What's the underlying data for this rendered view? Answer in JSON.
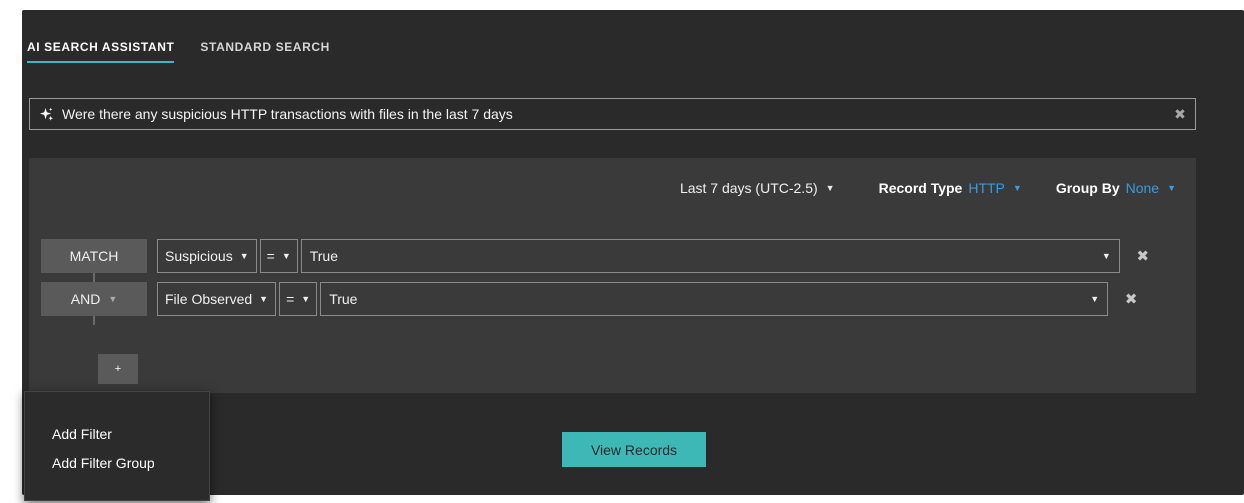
{
  "tabs": [
    {
      "label": "AI SEARCH ASSISTANT",
      "active": true
    },
    {
      "label": "STANDARD SEARCH",
      "active": false
    }
  ],
  "search": {
    "value": "Were there any suspicious HTTP transactions with files in the last 7 days",
    "icon": "sparkle-icon",
    "clear_icon": "close-icon"
  },
  "builder": {
    "time_range": "Last 7 days (UTC-2.5)",
    "record_type_label": "Record Type",
    "record_type_value": "HTTP",
    "group_by_label": "Group By",
    "group_by_value": "None",
    "rows": [
      {
        "operator": "MATCH",
        "field": "Suspicious",
        "comparator": "=",
        "value": "True"
      },
      {
        "operator": "AND",
        "field": "File Observed",
        "comparator": "=",
        "value": "True"
      }
    ],
    "add_label": "+"
  },
  "view_records_label": "View Records",
  "menu": {
    "items": [
      "Add Filter",
      "Add Filter Group"
    ]
  },
  "colors": {
    "accent": "#3eb8c0",
    "link_blue": "#3b9bdc",
    "panel_bg": "#2a2a2a",
    "builder_bg": "#3a3a3a"
  }
}
